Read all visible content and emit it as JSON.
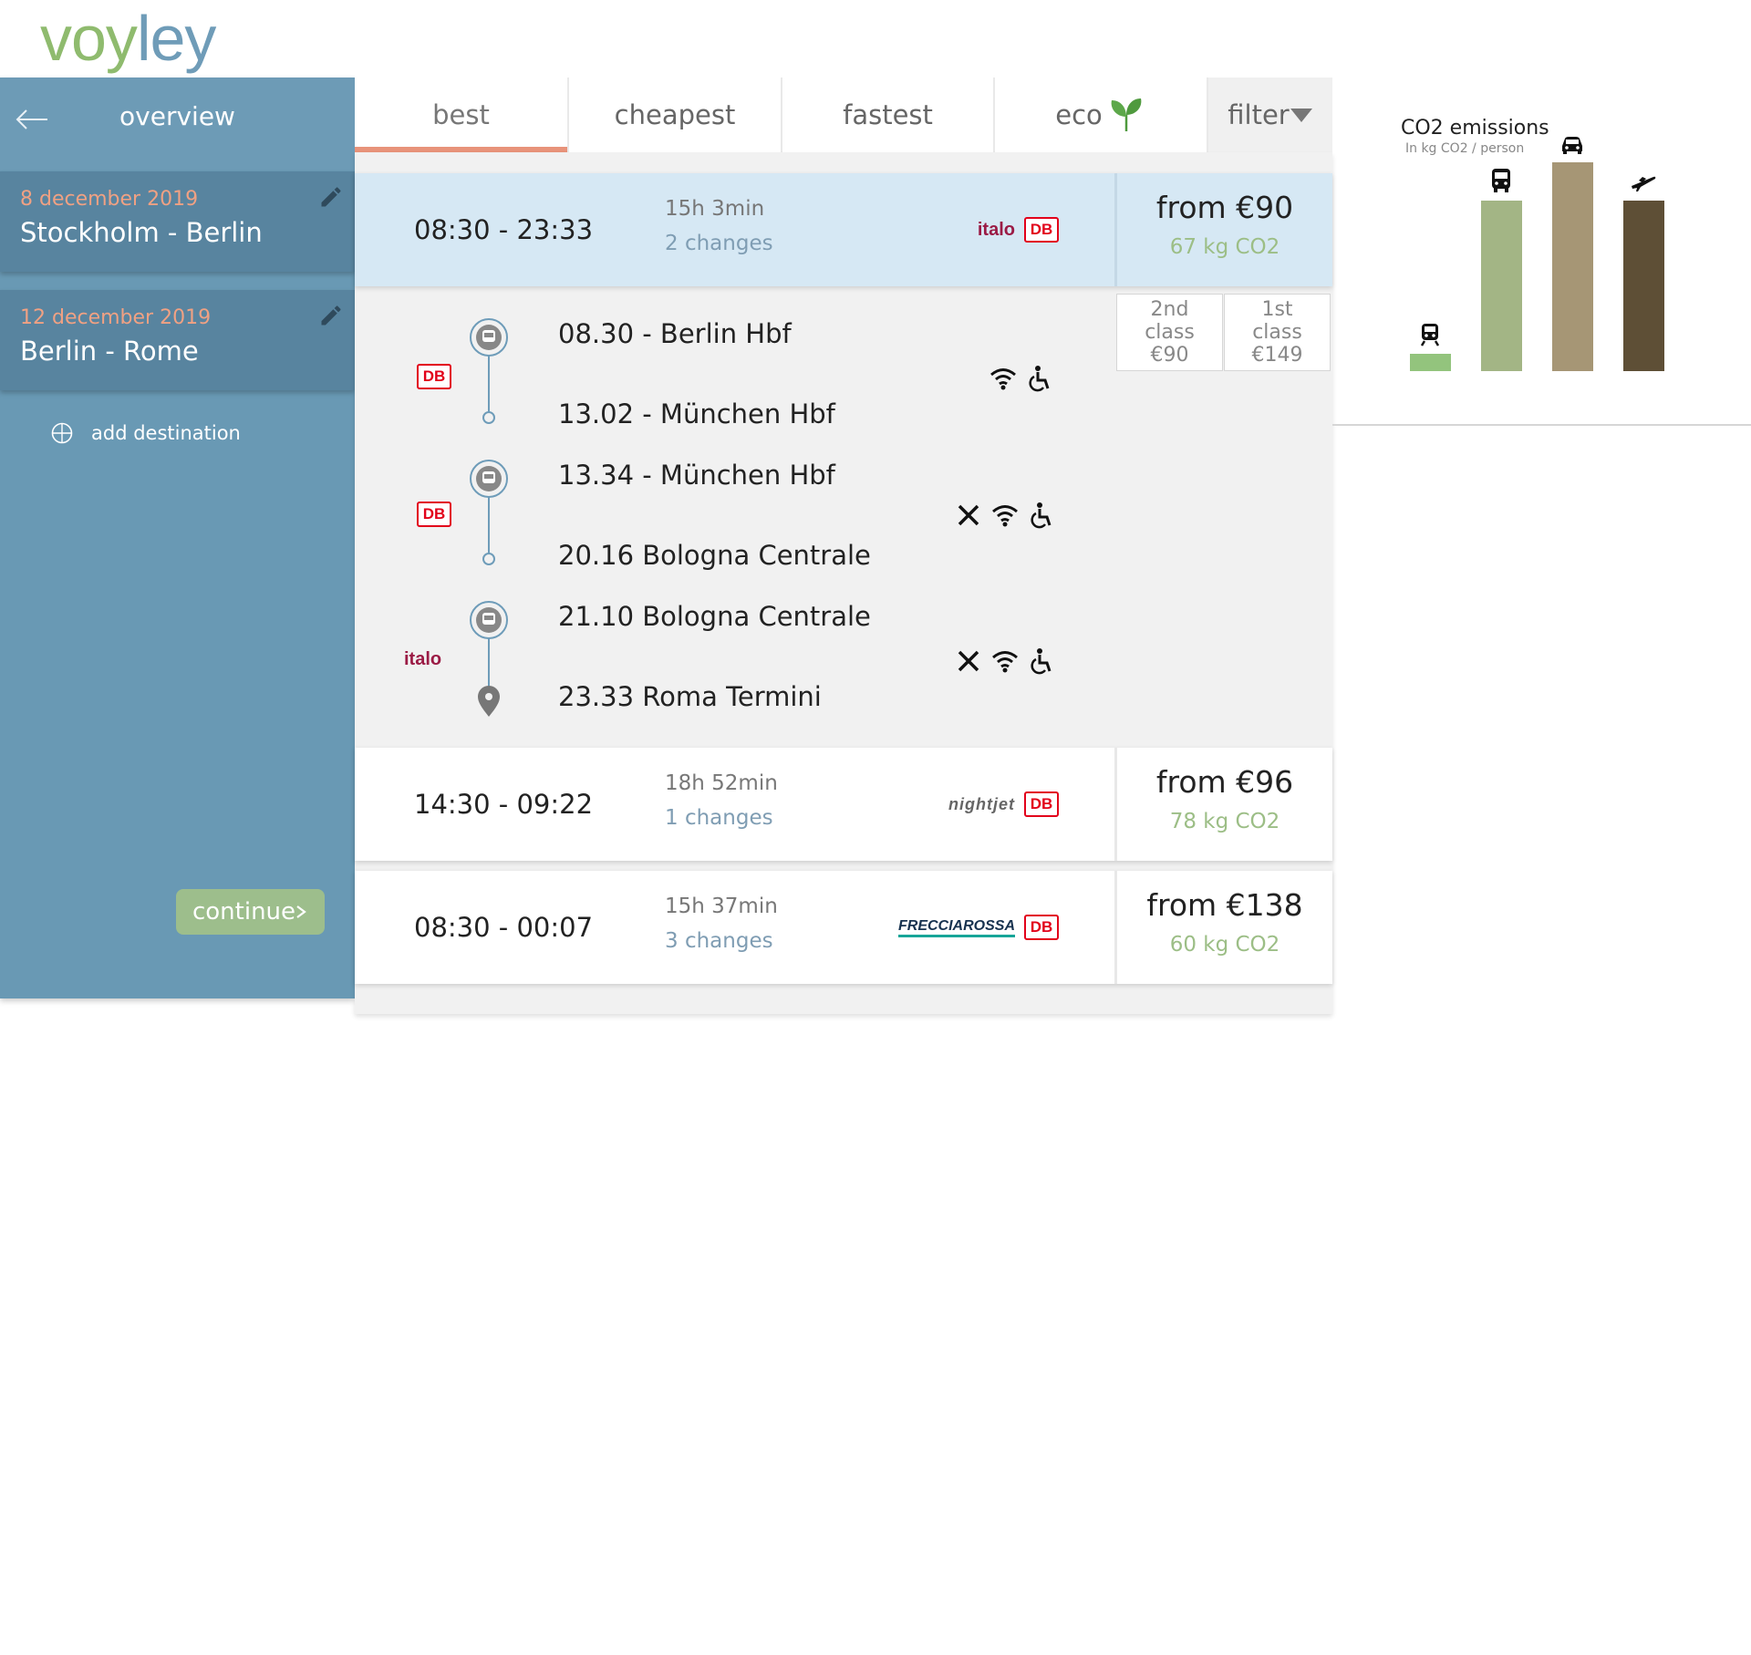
{
  "logo": {
    "part1": "voy",
    "part2": "ley"
  },
  "sidebar": {
    "back_icon": "back-arrow-icon",
    "title": "overview",
    "legs": [
      {
        "date": "8 december 2019",
        "route": "Stockholm - Berlin"
      },
      {
        "date": "12 december 2019",
        "route": "Berlin - Rome"
      }
    ],
    "add_destination": "add destination",
    "continue": "continue"
  },
  "tabs": [
    "best",
    "cheapest",
    "fastest",
    "eco",
    "filter"
  ],
  "results": [
    {
      "time": "08:30 - 23:33",
      "duration": "15h 3min",
      "changes": "2 changes",
      "price": "from €90",
      "co2": "67 kg CO2",
      "operators": [
        "italo",
        "DB"
      ]
    },
    {
      "time": "14:30 - 09:22",
      "duration": "18h 52min",
      "changes": "1 changes",
      "price": "from €96",
      "co2": "78 kg CO2",
      "operators": [
        "nightjet",
        "DB"
      ]
    },
    {
      "time": "08:30 - 00:07",
      "duration": "15h 37min",
      "changes": "3 changes",
      "price": "from €138",
      "co2": "60 kg CO2",
      "operators": [
        "FRECCIAROSSA",
        "DB"
      ]
    }
  ],
  "detail": {
    "segments": [
      {
        "operator": "DB",
        "from": "08.30 - Berlin Hbf",
        "to": "13.02 - München Hbf",
        "amenities": [
          "wifi",
          "wheelchair"
        ]
      },
      {
        "operator": "DB",
        "from": "13.34 - München Hbf",
        "to": "20.16 Bologna Centrale",
        "amenities": [
          "restaurant",
          "wifi",
          "wheelchair"
        ]
      },
      {
        "operator": "italo",
        "from": "21.10 Bologna Centrale",
        "to": "23.33 Roma Termini",
        "amenities": [
          "restaurant",
          "wifi",
          "wheelchair"
        ]
      }
    ],
    "classes": [
      {
        "line1": "2nd",
        "line2": "class",
        "price": "€90"
      },
      {
        "line1": "1st",
        "line2": "class",
        "price": "€149"
      }
    ]
  },
  "chart_data": {
    "type": "bar",
    "title": "CO2 emissions",
    "subtitle": "In kg CO2 / person",
    "categories": [
      "train",
      "bus",
      "car",
      "plane"
    ],
    "values": [
      13,
      127,
      155,
      127
    ],
    "colors": [
      "#93c47d",
      "#a3b585",
      "#a69675",
      "#5e4f36"
    ],
    "ylim": [
      0,
      160
    ]
  }
}
